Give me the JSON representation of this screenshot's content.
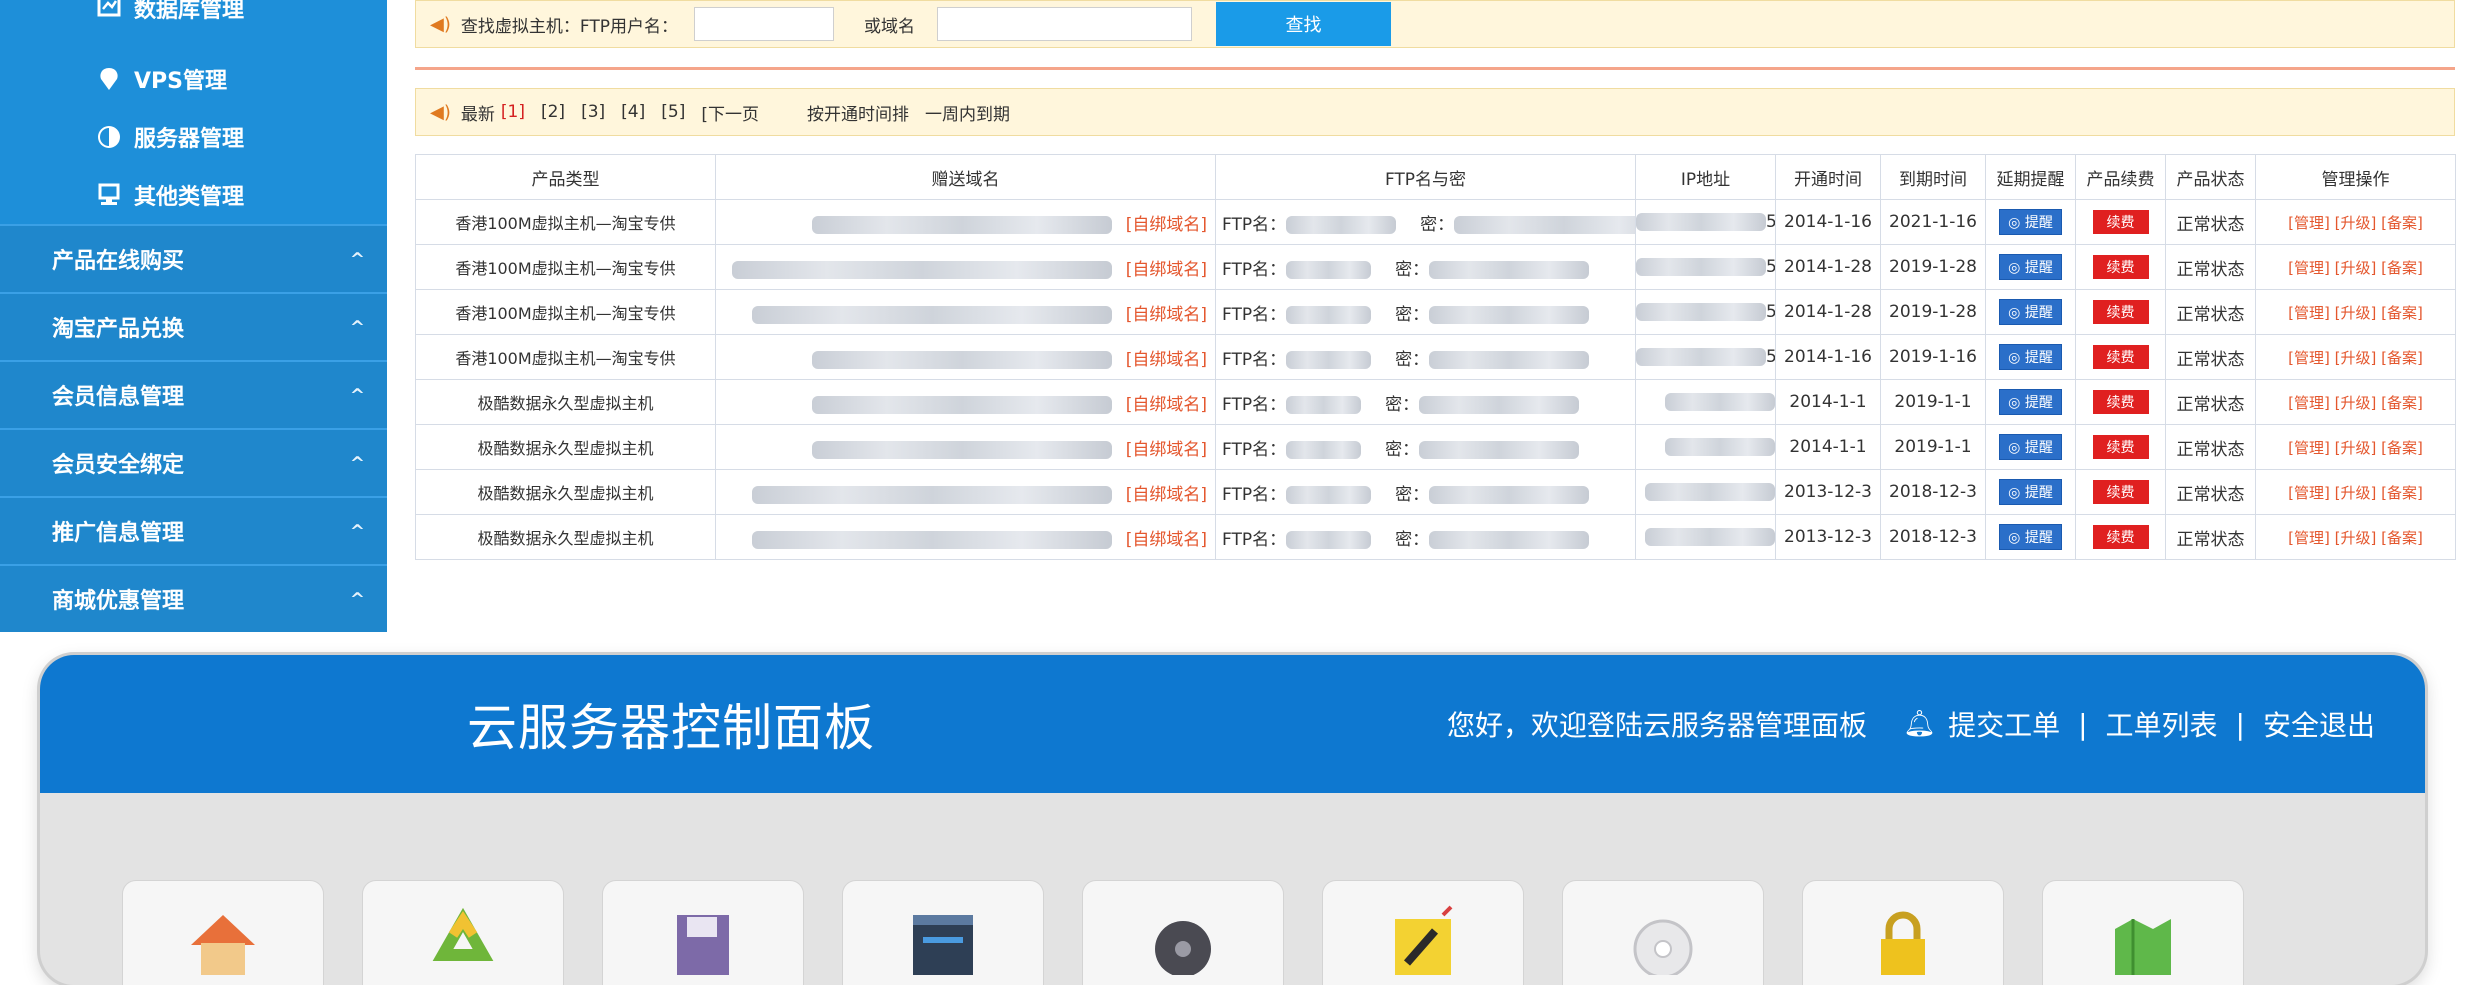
{
  "sidebar": {
    "sub_items": [
      {
        "label": "数据库管理",
        "icon": "database-icon"
      },
      {
        "label": "VPS管理",
        "icon": "vps-icon"
      },
      {
        "label": "服务器管理",
        "icon": "server-icon"
      },
      {
        "label": "其他类管理",
        "icon": "other-icon"
      }
    ],
    "main_items": [
      {
        "label": "产品在线购买",
        "chevron": "^"
      },
      {
        "label": "淘宝产品兑换",
        "chevron": "^"
      },
      {
        "label": "会员信息管理",
        "chevron": "^"
      },
      {
        "label": "会员安全绑定",
        "chevron": "^"
      },
      {
        "label": "推广信息管理",
        "chevron": "^"
      },
      {
        "label": "商城优惠管理",
        "chevron": "^"
      }
    ]
  },
  "search": {
    "label": "查找虚拟主机：FTP用户名：",
    "domain_label": "或域名",
    "button": "查找"
  },
  "pager": {
    "latest": "最新",
    "pages": [
      "[1]",
      "[2]",
      "[3]",
      "[4]",
      "[5]"
    ],
    "next": "[下一页",
    "sort": "按开通时间排",
    "expiring": "一周内到期"
  },
  "table": {
    "headers": [
      "产品类型",
      "赠送域名",
      "FTP名与密",
      "IP地址",
      "开通时间",
      "到期时间",
      "延期提醒",
      "产品续费",
      "产品状态",
      "管理操作"
    ],
    "rows": [
      {
        "type": "香港100M虚拟主机—淘宝专供",
        "bind": "[自绑域名]",
        "ftp": "FTP名：",
        "pwd": "密：",
        "ip_tail": "5",
        "open": "2014-1-16",
        "expire": "2021-1-16",
        "remind": "◎ 提醒",
        "renew": "续费",
        "status": "正常状态",
        "ops": "[管理] [升级] [备案]"
      },
      {
        "type": "香港100M虚拟主机—淘宝专供",
        "bind": "[自绑域名]",
        "ftp": "FTP名：",
        "pwd": "密：",
        "ip_tail": "5",
        "open": "2014-1-28",
        "expire": "2019-1-28",
        "remind": "◎ 提醒",
        "renew": "续费",
        "status": "正常状态",
        "ops": "[管理] [升级] [备案]"
      },
      {
        "type": "香港100M虚拟主机—淘宝专供",
        "bind": "[自绑域名]",
        "ftp": "FTP名：",
        "pwd": "密：",
        "ip_tail": "5",
        "open": "2014-1-28",
        "expire": "2019-1-28",
        "remind": "◎ 提醒",
        "renew": "续费",
        "status": "正常状态",
        "ops": "[管理] [升级] [备案]"
      },
      {
        "type": "香港100M虚拟主机—淘宝专供",
        "bind": "[自绑域名]",
        "ftp": "FTP名：",
        "pwd": "密：",
        "ip_tail": "5",
        "open": "2014-1-16",
        "expire": "2019-1-16",
        "remind": "◎ 提醒",
        "renew": "续费",
        "status": "正常状态",
        "ops": "[管理] [升级] [备案]"
      },
      {
        "type": "极酷数据永久型虚拟主机",
        "bind": "[自绑域名]",
        "ftp": "FTP名：",
        "pwd": "密：",
        "ip_tail": "",
        "open": "2014-1-1",
        "expire": "2019-1-1",
        "remind": "◎ 提醒",
        "renew": "续费",
        "status": "正常状态",
        "ops": "[管理] [升级] [备案]"
      },
      {
        "type": "极酷数据永久型虚拟主机",
        "bind": "[自绑域名]",
        "ftp": "FTP名：",
        "pwd": "密：",
        "ip_tail": "",
        "open": "2014-1-1",
        "expire": "2019-1-1",
        "remind": "◎ 提醒",
        "renew": "续费",
        "status": "正常状态",
        "ops": "[管理] [升级] [备案]"
      },
      {
        "type": "极酷数据永久型虚拟主机",
        "bind": "[自绑域名]",
        "ftp": "FTP名：",
        "pwd": "密：",
        "ip_tail": "",
        "open": "2013-12-3",
        "expire": "2018-12-3",
        "remind": "◎ 提醒",
        "renew": "续费",
        "status": "正常状态",
        "ops": "[管理] [升级] [备案]"
      },
      {
        "type": "极酷数据永久型虚拟主机",
        "bind": "[自绑域名]",
        "ftp": "FTP名：",
        "pwd": "密：",
        "ip_tail": "",
        "open": "2013-12-3",
        "expire": "2018-12-3",
        "remind": "◎ 提醒",
        "renew": "续费",
        "status": "正常状态",
        "ops": "[管理] [升级] [备案]"
      }
    ]
  },
  "panel": {
    "title": "云服务器控制面板",
    "welcome": "您好，欢迎登陆云服务器管理面板",
    "submit_ticket": "提交工单",
    "ticket_list": "工单列表",
    "logout": "安全退出",
    "sep": "|",
    "tiles": [
      "home-icon",
      "recycle-icon",
      "save-icon",
      "browser-icon",
      "disc-icon",
      "tools-icon",
      "cd-icon",
      "lock-icon",
      "map-icon"
    ]
  }
}
